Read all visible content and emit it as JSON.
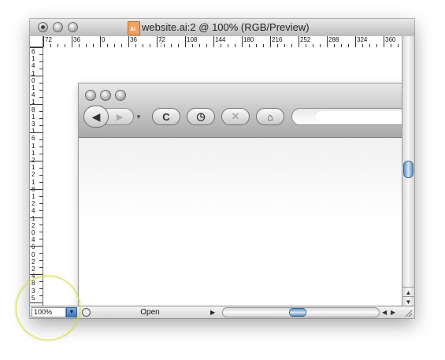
{
  "window": {
    "title": "website.ai:2 @ 100% (RGB/Preview)",
    "doc_icon_label": "Ai"
  },
  "ruler": {
    "h_labels": [
      "72",
      "36",
      "0",
      "36",
      "72",
      "108",
      "144",
      "180",
      "216",
      "252",
      "288",
      "324",
      "360"
    ],
    "v_digits": [
      "6",
      "1",
      "4",
      "1",
      "0",
      "1",
      "4",
      "1",
      "8",
      "1",
      "3",
      "1",
      "6",
      "1",
      "1",
      "2",
      "1",
      "2",
      "1",
      "8",
      "1",
      "2",
      "4",
      "1",
      "2",
      "0",
      "4",
      "6",
      "0",
      "2",
      "2",
      "4",
      "8",
      "3",
      "5"
    ]
  },
  "browser_mockup": {
    "back_glyph": "◀",
    "forward_glyph": "▶",
    "history_glyph": "▾",
    "reload_glyph": "C",
    "history_clock_glyph": "◷",
    "stop_glyph": "✕",
    "home_glyph": "⌂",
    "icons": [
      "back-arrow-icon",
      "forward-arrow-icon",
      "reload-icon",
      "clock-icon",
      "stop-icon",
      "home-icon"
    ]
  },
  "statusbar": {
    "zoom": "100%",
    "status_text": "Open"
  },
  "colors": {
    "scroll_thumb": "#5d8dbd",
    "highlight_circle": "#d9df3c"
  }
}
